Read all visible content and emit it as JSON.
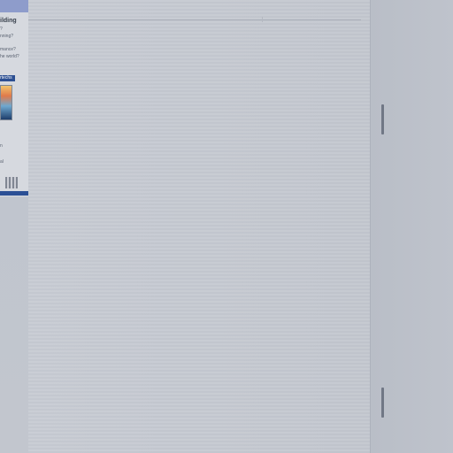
{
  "left_strip": {
    "title": "ilding",
    "lines": [
      "?",
      "nning?",
      "mance?",
      "he world?"
    ],
    "badge": "rtechs",
    "small_lines": [
      "n",
      "al"
    ]
  },
  "colors": {
    "background": "#c3c8d0",
    "panel": "#bcc1ca",
    "strip_header": "#8e9ccb",
    "accent": "#2b4f95"
  }
}
